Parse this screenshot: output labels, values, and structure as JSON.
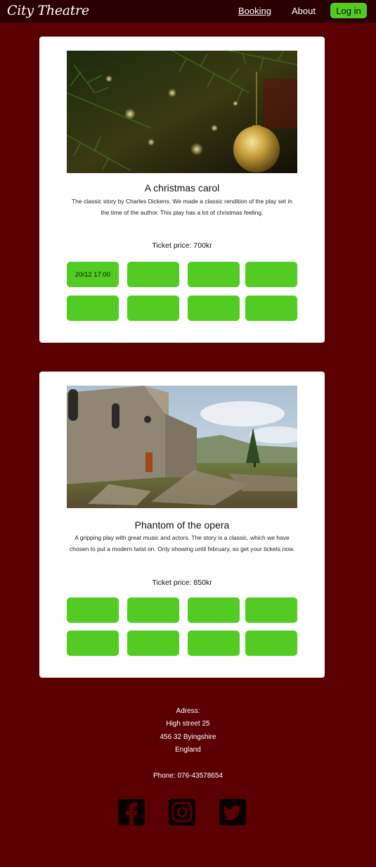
{
  "nav": {
    "logo": "City Theatre",
    "booking": "Booking",
    "about": "About",
    "login": "Log in"
  },
  "shows": [
    {
      "title": "A christmas carol",
      "description": "The classic story by Charles Dickens. We made a classic rendition of the play set in the time of the author. This play has a lot of christmas feeling.",
      "price": "Ticket price: 700kr",
      "slots": [
        "20/12 17:00",
        "",
        "",
        "",
        "",
        "",
        "",
        ""
      ]
    },
    {
      "title": "Phantom of the opera",
      "description": "A gripping play with great music and actors. The story is a classic, which we have chosen to put a modern twist on. Only showing until february, so get your tickets now.",
      "price": "Ticket price: 850kr",
      "slots": [
        "",
        "",
        "",
        "",
        "",
        "",
        "",
        ""
      ]
    }
  ],
  "footer": {
    "address_label": "Adress:",
    "street": "High  street 25",
    "postal": "456 32 Byingshire",
    "country": "England",
    "phone": "Phone: 076-43578654"
  },
  "social": [
    "facebook-icon",
    "instagram-icon",
    "twitter-icon"
  ],
  "colors": {
    "background": "#5a0003",
    "navbar": "#2a0000",
    "accent_green": "#52cc22",
    "card": "#ffffff"
  }
}
